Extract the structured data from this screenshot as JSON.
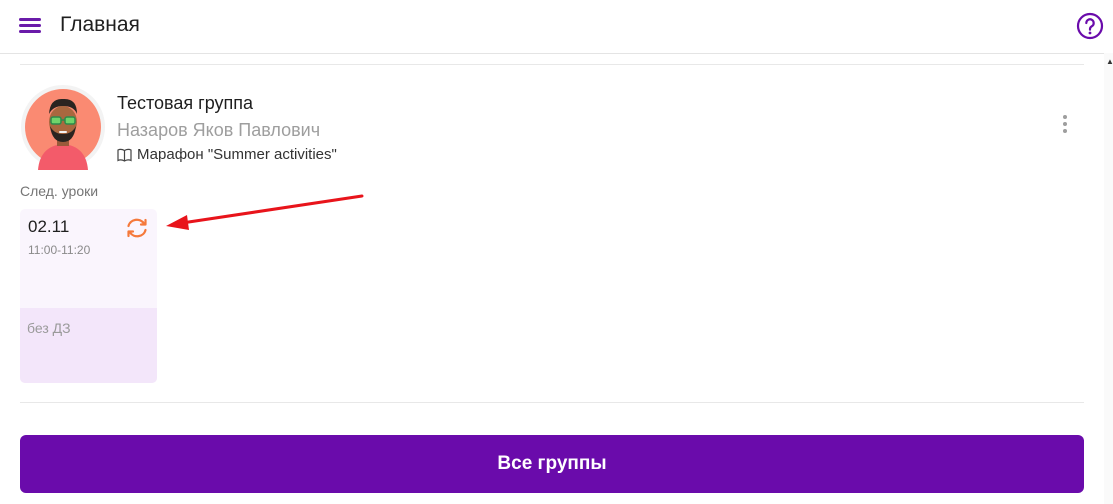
{
  "header": {
    "title": "Главная",
    "menu_icon": "hamburger-menu-icon",
    "help_icon": "question-circle-icon"
  },
  "group": {
    "name": "Тестовая группа",
    "teacher": "Назаров Яков Павлович",
    "course": "Марафон \"Summer activities\"",
    "avatar_icon": "avatar-bearded-man-glasses",
    "course_icon": "book-icon",
    "menu_icon": "kebab-menu-icon"
  },
  "next_lessons": {
    "label": "След. уроки",
    "items": [
      {
        "date": "02.11",
        "time": "11:00-11:20",
        "homework": "без ДЗ",
        "icon": "reschedule-icon"
      }
    ]
  },
  "footer": {
    "all_groups_label": "Все группы"
  },
  "colors": {
    "brand": "#6a0bab",
    "accent_orange": "#f5793b",
    "annotation_arrow": "#e8141b",
    "card_top": "#faf5fd",
    "card_bottom": "#f3e6fa"
  }
}
